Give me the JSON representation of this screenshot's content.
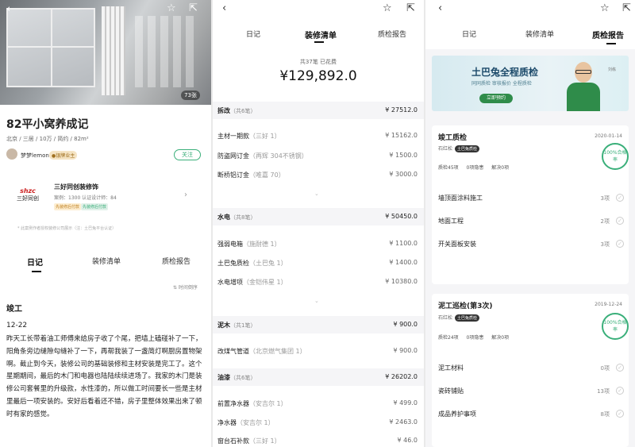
{
  "p1": {
    "photo_count": "73张",
    "title": "82平小窝养成记",
    "meta": "北京 / 三居 / 10万 / 简约 / 82m²",
    "user": {
      "name": "梦梦lemon",
      "level": "●银牌业主"
    },
    "follow_label": "关注",
    "company": {
      "logo_line1": "shzc",
      "logo_line2": "三好同创",
      "name": "三好同创装修饰",
      "stats": "案例：1300   认证设计师：84",
      "tag1": "先装修后付款",
      "tag2": "先装修后付款"
    },
    "fine_print": "* 此案例作者授权装修公司展示（注：土巴兔平台认证）",
    "tabs": [
      "日记",
      "装修清单",
      "质检报告"
    ],
    "sort_label": "⇅ 时间倒序",
    "section": "竣工",
    "date": "12-22",
    "paragraph": "昨天工长带着油工师傅来给房子收了个尾，把墙上磕碰补了一下，阳角条旁边缝隙勾缝补了一下，再帮我装了一盏简灯啊厨房置物架啊。截止到今天，装修公司的基础装修和主材安装是完工了。这个星期期间，最后的木门和电器也陆陆续续进场了。我家的木门是装修公司套餐里的升级款，水性漆的，所以做工时间要长一些是主材里最后一项安装的。安好后看着还不错，房子里整体效果出来了顿时有家的感觉。"
  },
  "p2": {
    "tabs": [
      "日记",
      "装修清单",
      "质检报告"
    ],
    "total_label": "共37笔  已花费",
    "total_amount": "¥129,892.0",
    "groups": [
      {
        "name": "拆改",
        "count": "（共6笔）",
        "amount": "¥ 27512.0",
        "items": [
          {
            "name": "主材一期款",
            "brand": "（三好 1）",
            "amount": "¥ 15162.0"
          },
          {
            "name": "防盗网订金",
            "brand": "（再辉 304不锈钢）",
            "amount": "¥ 1500.0"
          },
          {
            "name": "断桥铝订金",
            "brand": "（唯嘉 70）",
            "amount": "¥ 3000.0"
          }
        ]
      },
      {
        "name": "水电",
        "count": "（共8笔）",
        "amount": "¥ 50450.0",
        "items": [
          {
            "name": "强弱电箱",
            "brand": "（施耐德 1）",
            "amount": "¥ 1100.0"
          },
          {
            "name": "土巴兔质检",
            "brand": "（土巴兔 1）",
            "amount": "¥ 1400.0"
          },
          {
            "name": "水电增项",
            "brand": "（金铠伟星 1）",
            "amount": "¥ 10380.0"
          }
        ]
      },
      {
        "name": "泥木",
        "count": "（共1笔）",
        "amount": "¥ 900.0",
        "items": [
          {
            "name": "改煤气管道",
            "brand": "（北京燃气集团 1）",
            "amount": "¥ 900.0"
          }
        ]
      },
      {
        "name": "油漆",
        "count": "（共6笔）",
        "amount": "¥ 26202.0",
        "items": [
          {
            "name": "前置净水器",
            "brand": "（安吉尔 1）",
            "amount": "¥ 499.0"
          },
          {
            "name": "净水器",
            "brand": "（安吉尔 1）",
            "amount": "¥ 2463.0"
          },
          {
            "name": "窗台石补款",
            "brand": "（三好 1）",
            "amount": "¥ 46.0"
          }
        ]
      }
    ]
  },
  "p3": {
    "tabs": [
      "日记",
      "装修清单",
      "质检报告"
    ],
    "banner": {
      "title": "土巴兔全程质检",
      "sub": "同同质检  审核报价  全程质检",
      "button": "立即预约",
      "person": "刘栋"
    },
    "cards": [
      {
        "title": "竣工质检",
        "date": "2020-01-14",
        "inspector": "石红松",
        "tag": "土巴兔质检",
        "stats": "质检45项 0项隐患 解决0项",
        "stamp": "100%合格率",
        "items": [
          {
            "name": "墙顶面涂料施工",
            "count": "3项"
          },
          {
            "name": "地面工程",
            "count": "2项"
          },
          {
            "name": "开关面板安装",
            "count": "3项"
          }
        ]
      },
      {
        "title": "泥工巡检(第3次)",
        "date": "2019-12-24",
        "inspector": "石红松",
        "tag": "土巴兔质检",
        "stats": "质检24项 0项隐患 解决0项",
        "stamp": "100%合格率",
        "items": [
          {
            "name": "泥工材料",
            "count": "0项"
          },
          {
            "name": "瓷砖铺贴",
            "count": "13项"
          },
          {
            "name": "成品养护事项",
            "count": "8项"
          }
        ]
      }
    ]
  },
  "icons": {
    "back": "chevron-left-icon",
    "star": "star-icon",
    "share": "share-icon"
  },
  "colors": {
    "accent": "#3aaf7a",
    "brand_green": "#2f8c4a"
  }
}
